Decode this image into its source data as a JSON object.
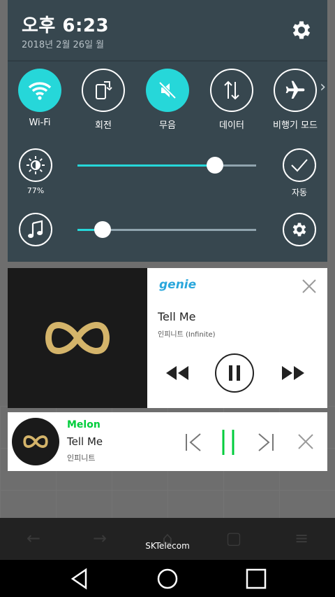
{
  "status": {
    "time": "오후 6:23",
    "date": "2018년 2월 26일 월"
  },
  "quick_tiles": [
    {
      "label": "Wi-Fi",
      "icon": "wifi-icon",
      "on": true
    },
    {
      "label": "회전",
      "icon": "rotate-icon",
      "on": false
    },
    {
      "label": "무음",
      "icon": "mute-icon",
      "on": true
    },
    {
      "label": "데이터",
      "icon": "data-icon",
      "on": false
    },
    {
      "label": "비행기 모드",
      "icon": "airplane-icon",
      "on": false
    }
  ],
  "brightness": {
    "label": "77%",
    "value": 0.77,
    "auto_label": "자동"
  },
  "volume": {
    "value": 0.14
  },
  "genie_player": {
    "brand": "genie",
    "title": "Tell Me",
    "artist": "인피니트 (Infinite)"
  },
  "melon_player": {
    "brand": "Melon",
    "title": "Tell Me",
    "artist": "인피니트"
  },
  "carrier": "SKTelecom",
  "colors": {
    "accent": "#26d7d9",
    "panel": "#37474f",
    "genie": "#2aa7dc",
    "melon": "#00cd3c",
    "gold": "#d4b46a"
  }
}
